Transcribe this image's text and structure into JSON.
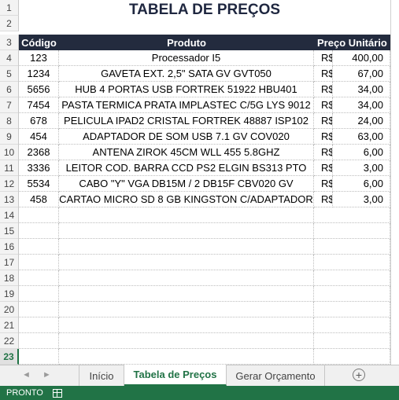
{
  "sheet": {
    "title": "TABELA DE PREÇOS",
    "headers": {
      "code": "Código",
      "product": "Produto",
      "price": "Preço Unitário"
    },
    "currency": "R$",
    "items": [
      {
        "row": "4",
        "code": "123",
        "product": "Processador I5",
        "price": "400,00"
      },
      {
        "row": "5",
        "code": "1234",
        "product": "GAVETA EXT. 2,5\" SATA GV GVT050",
        "price": "67,00"
      },
      {
        "row": "6",
        "code": "5656",
        "product": "HUB 4 PORTAS USB FORTREK 51922 HBU401",
        "price": "34,00"
      },
      {
        "row": "7",
        "code": "7454",
        "product": "PASTA TERMICA PRATA IMPLASTEC C/5G LYS 9012",
        "price": "34,00"
      },
      {
        "row": "8",
        "code": "678",
        "product": "PELICULA IPAD2 CRISTAL FORTREK 48887 ISP102",
        "price": "24,00"
      },
      {
        "row": "9",
        "code": "454",
        "product": "ADAPTADOR DE SOM USB 7.1 GV COV020",
        "price": "63,00"
      },
      {
        "row": "10",
        "code": "2368",
        "product": "ANTENA ZIROK 45CM WLL 455 5.8GHZ",
        "price": "6,00"
      },
      {
        "row": "11",
        "code": "3336",
        "product": "LEITOR COD. BARRA CCD PS2 ELGIN BS313 PTO",
        "price": "3,00"
      },
      {
        "row": "12",
        "code": "5534",
        "product": "CABO \"Y\" VGA DB15M / 2 DB15F CBV020 GV",
        "price": "6,00"
      },
      {
        "row": "13",
        "code": "458",
        "product": "CARTAO MICRO SD 8 GB KINGSTON C/ADAPTADOR",
        "price": "3,00"
      }
    ],
    "row_numbers": {
      "title_a": "1",
      "title_b": "2",
      "header": "3"
    },
    "empty_rows": [
      "14",
      "15",
      "16",
      "17",
      "18",
      "19",
      "20",
      "21",
      "22"
    ],
    "selected_row": "23"
  },
  "tabs": {
    "items": [
      "Início",
      "Tabela de Preços",
      "Gerar Orçamento"
    ],
    "active_index": 1,
    "prev_icon": "◄",
    "next_icon": "►",
    "add_icon": "+"
  },
  "status": {
    "text": "PRONTO"
  },
  "colors": {
    "header_bg": "#232b3e",
    "title_color": "#1f2740",
    "accent": "#217346"
  }
}
